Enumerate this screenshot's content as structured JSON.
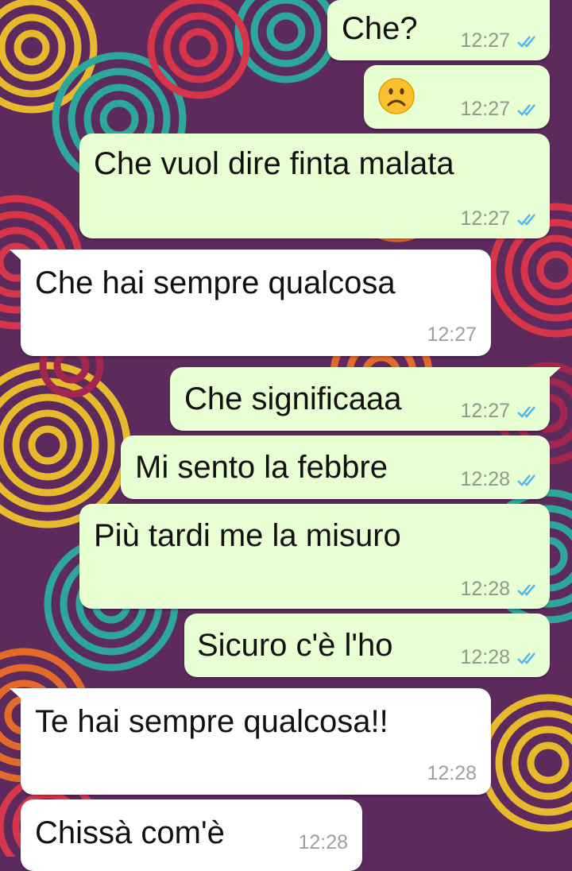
{
  "chat": {
    "messages": [
      {
        "direction": "outgoing",
        "text": "Che?",
        "time": "12:27",
        "status": "read"
      },
      {
        "direction": "outgoing",
        "text": "☹",
        "emoji": "frowning-face",
        "time": "12:27",
        "status": "read"
      },
      {
        "direction": "outgoing",
        "text": "Che vuol dire finta malata",
        "time": "12:27",
        "status": "read"
      },
      {
        "direction": "incoming",
        "text": "Che hai sempre qualcosa",
        "time": "12:27"
      },
      {
        "direction": "outgoing",
        "text": "Che significaaa",
        "time": "12:27",
        "status": "read"
      },
      {
        "direction": "outgoing",
        "text": "Mi sento la febbre",
        "time": "12:28",
        "status": "read"
      },
      {
        "direction": "outgoing",
        "text": "Più tardi me la misuro",
        "time": "12:28",
        "status": "read"
      },
      {
        "direction": "outgoing",
        "text": "Sicuro c'è l'ho",
        "time": "12:28",
        "status": "read"
      },
      {
        "direction": "incoming",
        "text": "Te hai sempre qualcosa!!",
        "time": "12:28"
      },
      {
        "direction": "incoming",
        "text": "Chissà com'è",
        "time": "12:28"
      }
    ]
  },
  "colors": {
    "outgoing_bubble": "#e8fed3",
    "incoming_bubble": "#ffffff",
    "read_ticks": "#4fb6ec",
    "timestamp": "#8f9a8d"
  },
  "icons": {
    "read_receipt": "double-check-icon",
    "message_emoji": "frowning-face-icon"
  }
}
